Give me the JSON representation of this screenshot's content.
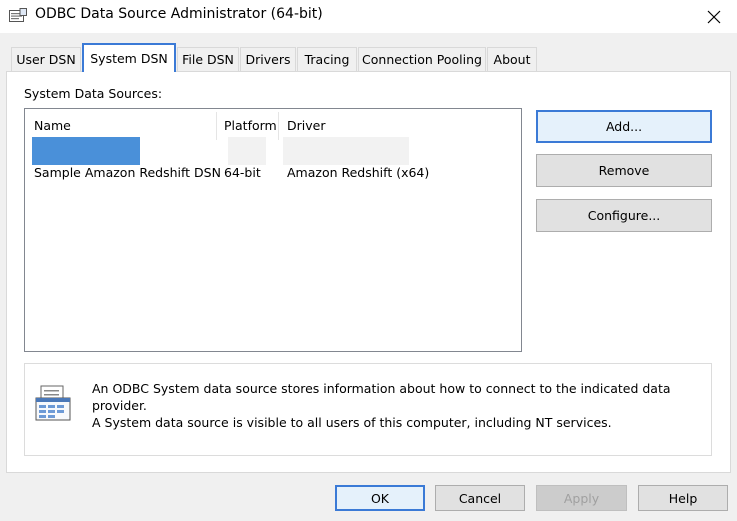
{
  "window": {
    "title": "ODBC Data Source Administrator (64-bit)",
    "icon": "odbc-admin-icon",
    "close_icon": "close-icon"
  },
  "tabs": [
    {
      "label": "User DSN"
    },
    {
      "label": "System DSN",
      "active": true
    },
    {
      "label": "File DSN"
    },
    {
      "label": "Drivers"
    },
    {
      "label": "Tracing"
    },
    {
      "label": "Connection Pooling"
    },
    {
      "label": "About"
    }
  ],
  "system_dsn": {
    "section_label": "System Data Sources:",
    "columns": [
      "Name",
      "Platform",
      "Driver"
    ],
    "rows": [
      {
        "name": "Sample Amazon Redshift DSN",
        "platform": "64-bit",
        "driver": "Amazon Redshift (x64)"
      }
    ],
    "buttons": {
      "add": "Add...",
      "remove": "Remove",
      "configure": "Configure..."
    },
    "info_icon": "data-source-document-icon",
    "info_line1": "An ODBC System data source stores information about how to connect to the indicated data provider.",
    "info_line2": "A System data source is visible to all users of this computer, including NT services."
  },
  "footer": {
    "ok": "OK",
    "cancel": "Cancel",
    "apply": "Apply",
    "help": "Help"
  },
  "colors": {
    "accent": "#3b7ad6",
    "selection": "#4a90d9"
  }
}
